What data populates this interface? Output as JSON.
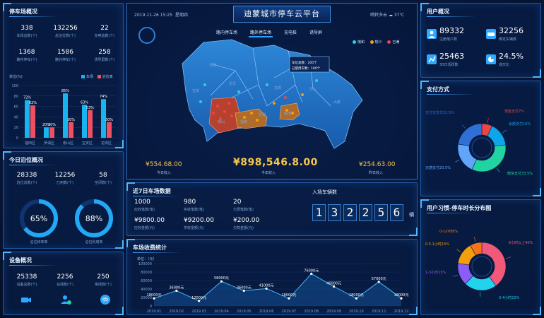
{
  "header": {
    "datetime": "2019-11-26  15:25",
    "weekday": "星期四",
    "title": "迪蒙城市停车云平台",
    "weather": "晴转多云",
    "temperature": "37℃",
    "tabs": [
      "路内停车场",
      "路外停车场",
      "充电桩",
      "诱导屏"
    ],
    "active_tab": 1
  },
  "map": {
    "legend": [
      "饱和",
      "较少",
      "已满"
    ],
    "legend_colors": [
      "#22d3ee",
      "#f59e0b",
      "#ef4444"
    ],
    "tooltip": {
      "line1": "车位总数：200个",
      "line2": "已使用车数：100个"
    },
    "districts": [
      "光明",
      "宝安",
      "龙华",
      "龙岗",
      "坪山",
      "南山",
      "福田",
      "罗湖",
      "盐田",
      "大鹏"
    ],
    "stats": {
      "today_income": "¥554.68.00",
      "today_income_label": "今日收入",
      "year_income": "¥898,546.8.00",
      "year_income_label": "今年收入",
      "yesterday_income": "¥254.63.00",
      "yesterday_income_label": "昨日收入"
    }
  },
  "parking_overview": {
    "title": "停车场概况",
    "stats": [
      {
        "value": "338",
        "label": "车场总数(个)"
      },
      {
        "value": "132256",
        "label": "总泊位数(个)"
      },
      {
        "value": "22",
        "label": "充电站数(个)"
      },
      {
        "value": "1368",
        "label": "路内停车(个)"
      },
      {
        "value": "1586",
        "label": "路外停车(个)"
      },
      {
        "value": "258",
        "label": "诱导屏数(个)"
      }
    ],
    "unit": "单位(%)",
    "legend": [
      "车场",
      "泊位率"
    ]
  },
  "today_parking": {
    "title": "今日泊位概况",
    "stats": [
      {
        "value": "28338",
        "label": "泊位总数(个)"
      },
      {
        "value": "12256",
        "label": "已用数(个)"
      },
      {
        "value": "58",
        "label": "空闲数(个)"
      }
    ],
    "gauge1": {
      "value": "65%",
      "label": "泊位转率率",
      "fraction": 0.65
    },
    "gauge2": {
      "value": "88%",
      "label": "泊位利用率",
      "fraction": 0.88
    }
  },
  "device_overview": {
    "title": "设备概况",
    "stats": [
      {
        "value": "25338",
        "label": "设备总数(个)"
      },
      {
        "value": "2256",
        "label": "在线数(个)"
      },
      {
        "value": "250",
        "label": "离线数(个)"
      }
    ]
  },
  "seven_days": {
    "title": "近7日车场数据",
    "stats": [
      {
        "value": "1000",
        "label": "应收笔数(笔)"
      },
      {
        "value": "980",
        "label": "实收笔数(笔)"
      },
      {
        "value": "20",
        "label": "欠费笔数(笔)"
      },
      {
        "value": "¥9800.00",
        "label": "应收金额(元)"
      },
      {
        "value": "¥9200.00",
        "label": "实收金额(元)"
      },
      {
        "value": "¥200.00",
        "label": "欠款金额(元)"
      }
    ],
    "entry_title": "入场车辆数",
    "entry_digits": [
      "1",
      "3",
      "2",
      "2",
      "5",
      "6"
    ],
    "entry_unit": "辆"
  },
  "fee_chart": {
    "title": "车场收费统计",
    "unit": "单位：（元）"
  },
  "user_overview": {
    "title": "用户概况",
    "stats": [
      {
        "value": "89332",
        "label": "注册用户数"
      },
      {
        "value": "32256",
        "label": "绑定车辆数"
      },
      {
        "value": "25463",
        "label": "30日活跃数"
      },
      {
        "value": "24.5%",
        "label": "成交比"
      }
    ]
  },
  "payment": {
    "title": "支付方式"
  },
  "habit": {
    "title": "用户习惯-停车时长分布图"
  },
  "colors": {
    "accent": "#31a0ff",
    "gold": "#f8c64a",
    "bg": "#061433"
  },
  "chart_data": [
    {
      "type": "bar",
      "categories": [
        "福田区",
        "罗湖区",
        "南山区",
        "宝安区",
        "龙岗区"
      ],
      "series": [
        {
          "name": "车场",
          "values": [
            72,
            20,
            85,
            63,
            74
          ]
        },
        {
          "name": "泊位率",
          "values": [
            62,
            20,
            30,
            53,
            30
          ]
        }
      ],
      "value_labels": [
        [
          "72%",
          "20%",
          "85%",
          "63%",
          "74%"
        ],
        [
          "62%",
          "20%",
          "30%",
          "53%",
          "30%"
        ]
      ],
      "ylabel": "单位(%)",
      "ylim": [
        0,
        100
      ],
      "yticks": [
        0,
        20,
        40,
        60,
        80,
        100
      ]
    },
    {
      "type": "area",
      "x": [
        "2019.01",
        "2019.02",
        "2019.03",
        "2019.04",
        "2019.05",
        "2019.06",
        "2019.07",
        "2019.08",
        "2019.09",
        "2019.10",
        "2019.11",
        "2019.12"
      ],
      "values": [
        18000,
        36000,
        12000,
        58000,
        36000,
        41000,
        18000,
        76000,
        46000,
        18000,
        57000,
        18000
      ],
      "value_labels": [
        "18000元",
        "36000元",
        "12000元",
        "58000元",
        "36000元",
        "41000元",
        "18000元",
        "76000元",
        "46000元",
        "18000元",
        "57000元",
        "18000元"
      ],
      "ylabel": "单位：（元）",
      "ylim": [
        0,
        100000
      ],
      "yticks": [
        0,
        20000,
        40000,
        60000,
        80000,
        100000
      ]
    },
    {
      "type": "pie",
      "labels": [
        "现金支付",
        "余额支付",
        "微信支付",
        "无感支付",
        "支付宝支付"
      ],
      "label_texts": [
        "现金支付7%",
        "余额支付16%",
        "微信支付33.5%",
        "无感支付20.5%",
        "支付宝支付22.5%"
      ],
      "values": [
        7,
        16,
        33.5,
        20.5,
        22.5
      ],
      "colors": [
        "#ef4444",
        "#0ea5e9",
        "#22d3a2",
        "#60a5fa",
        "#2f6fd6"
      ]
    },
    {
      "type": "pie",
      "labels": [
        "6小时以上",
        "3-4小时",
        "1-3小时",
        "0.5-1小时",
        "0-1小时"
      ],
      "label_texts": [
        "6小时以上40%",
        "3-4小时22%",
        "1-3小时15%",
        "0.5-1小时15%",
        "0-1小时8%"
      ],
      "values": [
        40,
        22,
        15,
        15,
        8
      ],
      "colors": [
        "#f0597a",
        "#22d3ee",
        "#8b5cf6",
        "#f59e0b",
        "#f97316"
      ]
    }
  ]
}
